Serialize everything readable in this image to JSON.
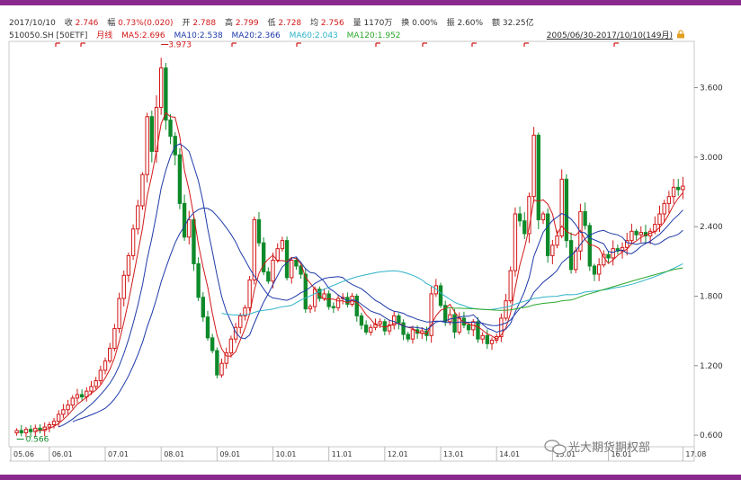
{
  "header": {
    "date": "2017/10/10",
    "close_label": "收",
    "close_value": "2.746",
    "change_label": "幅",
    "change_value": "0.73%(0.020)",
    "open_label": "开",
    "open_value": "2.788",
    "high_label": "高",
    "high_value": "2.799",
    "low_label": "低",
    "low_value": "2.728",
    "avg_label": "均",
    "avg_value": "2.756",
    "vol_label": "量",
    "vol_value": "1170万",
    "turnover_label": "换",
    "turnover_value": "0.00%",
    "amplitude_label": "振",
    "amplitude_value": "2.60%",
    "amount_label": "额",
    "amount_value": "32.25亿"
  },
  "subheader": {
    "code": "510050.SH [50ETF]",
    "period": "月线",
    "ma5": "MA5:2.696",
    "ma10": "MA10:2.538",
    "ma20": "MA20:2.366",
    "ma60": "MA60:2.043",
    "ma120": "MA120:1.952",
    "range": "2005/06/30-2017/10/10(149月)"
  },
  "watermark": "光大期货期权部",
  "colors": {
    "up": "#d21818",
    "down": "#0f8a2a",
    "ma5": "#d21818",
    "ma10": "#1e3aa8",
    "ma20": "#1e3aa8",
    "ma60": "#2fb3c8",
    "ma120": "#2aa82a",
    "frame": "#8b2a8e"
  },
  "chart_data": {
    "type": "candlestick",
    "x_ticks": [
      "05.06",
      "06.01",
      "07.01",
      "08.01",
      "09.01",
      "10.01",
      "11.01",
      "12.01",
      "13.01",
      "14.01",
      "15.01",
      "16.01",
      "17.08"
    ],
    "y_ticks": [
      "3.600",
      "3.000",
      "2.400",
      "1.800",
      "1.200",
      "0.600"
    ],
    "ylim": [
      0.5,
      4.0
    ],
    "annotations": [
      {
        "label": "3.973",
        "value": 3.973
      },
      {
        "label": "0.566",
        "value": 0.566
      }
    ],
    "series_names": [
      "MA5",
      "MA10",
      "MA20",
      "MA60",
      "MA120"
    ],
    "closes": [
      0.64,
      0.62,
      0.65,
      0.63,
      0.66,
      0.64,
      0.67,
      0.69,
      0.72,
      0.78,
      0.82,
      0.86,
      0.92,
      0.95,
      0.93,
      0.98,
      1.02,
      1.07,
      1.16,
      1.24,
      1.35,
      1.52,
      1.78,
      1.98,
      2.15,
      2.38,
      2.58,
      2.85,
      3.35,
      3.05,
      3.43,
      3.77,
      3.32,
      3.18,
      3.02,
      2.6,
      2.31,
      2.46,
      2.08,
      1.79,
      1.62,
      1.44,
      1.33,
      1.12,
      1.22,
      1.31,
      1.43,
      1.53,
      1.63,
      1.7,
      1.94,
      2.46,
      2.26,
      2.01,
      1.93,
      2.11,
      2.21,
      2.28,
      1.96,
      2.11,
      2.06,
      1.99,
      1.69,
      1.71,
      1.86,
      1.78,
      1.82,
      1.71,
      1.7,
      1.78,
      1.79,
      1.73,
      1.8,
      1.63,
      1.55,
      1.49,
      1.53,
      1.56,
      1.58,
      1.5,
      1.55,
      1.63,
      1.57,
      1.47,
      1.43,
      1.51,
      1.48,
      1.5,
      1.46,
      1.82,
      1.89,
      1.72,
      1.58,
      1.64,
      1.49,
      1.61,
      1.55,
      1.51,
      1.58,
      1.43,
      1.46,
      1.39,
      1.42,
      1.45,
      1.61,
      1.76,
      2.02,
      2.51,
      2.45,
      2.34,
      2.66,
      3.19,
      2.46,
      2.51,
      2.15,
      2.24,
      2.32,
      2.81,
      2.28,
      2.03,
      2.19,
      2.53,
      2.41,
      2.06,
      1.99,
      2.07,
      2.16,
      2.13,
      2.21,
      2.19,
      2.22,
      2.28,
      2.36,
      2.33,
      2.35,
      2.32,
      2.36,
      2.42,
      2.51,
      2.6,
      2.66,
      2.74,
      2.72,
      2.75
    ]
  }
}
